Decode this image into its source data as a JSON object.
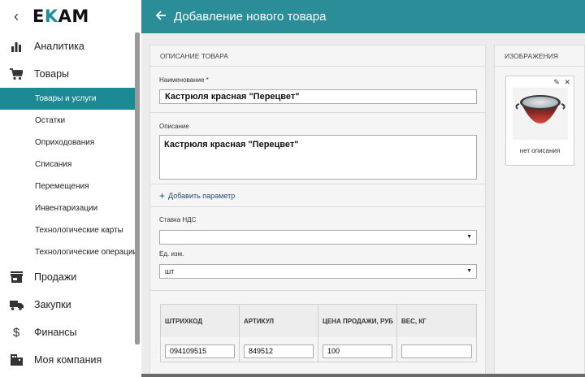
{
  "app": {
    "logo_part1": "E",
    "logo_k": "K",
    "logo_part2": "AM"
  },
  "sidebar": {
    "main_items": [
      {
        "label": "Аналитика",
        "icon": "bar-chart-icon"
      },
      {
        "label": "Товары",
        "icon": "cart-icon"
      },
      {
        "label": "Продажи",
        "icon": "store-icon"
      },
      {
        "label": "Закупки",
        "icon": "truck-icon"
      },
      {
        "label": "Финансы",
        "icon": "dollar-icon"
      },
      {
        "label": "Моя компания",
        "icon": "building-icon"
      }
    ],
    "sub_items": [
      "Товары и услуги",
      "Остатки",
      "Оприходования",
      "Списания",
      "Перемещения",
      "Инвентаризации",
      "Технологические карты",
      "Технологические операции"
    ]
  },
  "header": {
    "title": "Добавление нового товара"
  },
  "form": {
    "section_title": "ОПИСАНИЕ ТОВАРА",
    "name_label": "Наименование *",
    "name_value": "Кастрюля красная \"Перецвет\"",
    "desc_label": "Описание",
    "desc_value": "Кастрюля красная \"Перецвет\"",
    "add_param": "Добавить параметр",
    "vat_label": "Ставка НДС",
    "vat_value": "",
    "unit_label": "Ед. изм.",
    "unit_value": "шт",
    "table": {
      "headers": [
        "ШТРИХКОД",
        "АРТИКУЛ",
        "ЦЕНА ПРОДАЖИ, РУБ",
        "ВЕС, КГ"
      ],
      "values": [
        "094109515",
        "849512",
        "100",
        ""
      ]
    }
  },
  "images": {
    "section_title": "ИЗОБРАЖЕНИЯ",
    "caption": "нет описания"
  },
  "colors": {
    "accent": "#2b8d97",
    "active": "#1b8a94"
  }
}
